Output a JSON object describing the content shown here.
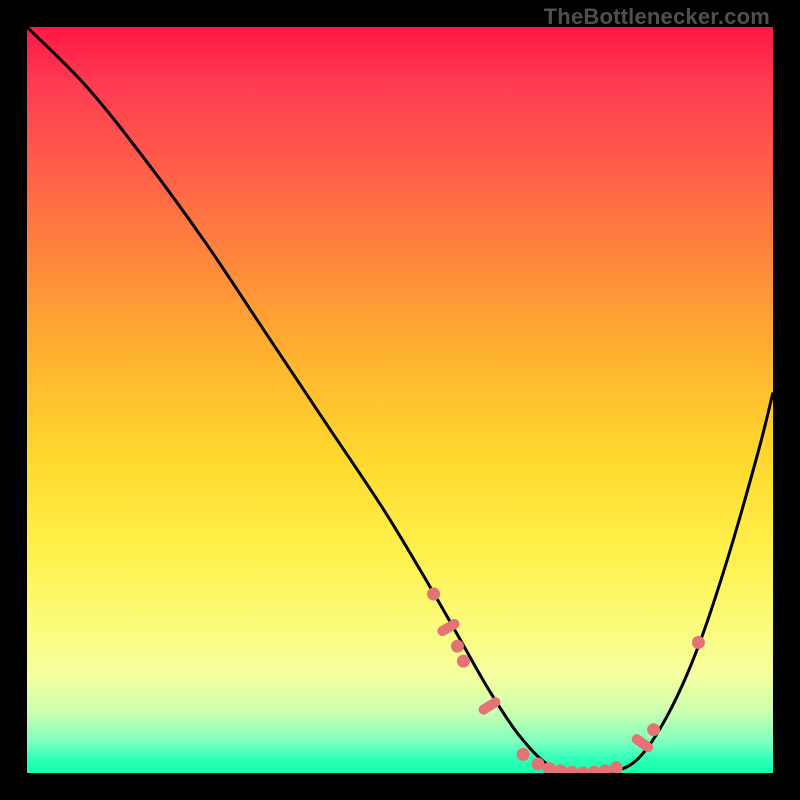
{
  "attribution": "TheBottlenecker.com",
  "chart_data": {
    "type": "line",
    "title": "",
    "xlabel": "",
    "ylabel": "",
    "xlim": [
      0,
      100
    ],
    "ylim": [
      0,
      100
    ],
    "series": [
      {
        "name": "curve",
        "x": [
          0,
          8,
          16,
          24,
          32,
          40,
          48,
          54,
          58,
          62,
          66,
          70,
          74,
          78,
          82,
          86,
          90,
          94,
          98,
          100
        ],
        "values": [
          100,
          92,
          82,
          71,
          59,
          47,
          35,
          25,
          18,
          11,
          5,
          1,
          0,
          0,
          2,
          8,
          17,
          29,
          43,
          51
        ]
      }
    ],
    "markers": [
      {
        "shape": "circle",
        "x": 54.5,
        "y": 24.0
      },
      {
        "shape": "pill",
        "x": 56.5,
        "y": 19.5,
        "angle": 60
      },
      {
        "shape": "circle",
        "x": 57.7,
        "y": 17.0
      },
      {
        "shape": "circle",
        "x": 58.5,
        "y": 15.0
      },
      {
        "shape": "pill",
        "x": 62.0,
        "y": 9.0,
        "angle": 58
      },
      {
        "shape": "circle",
        "x": 66.5,
        "y": 2.5
      },
      {
        "shape": "circle",
        "x": 68.5,
        "y": 1.2
      },
      {
        "shape": "circle",
        "x": 70.0,
        "y": 0.6
      },
      {
        "shape": "circle",
        "x": 71.5,
        "y": 0.3
      },
      {
        "shape": "circle",
        "x": 73.0,
        "y": 0.1
      },
      {
        "shape": "circle",
        "x": 74.5,
        "y": 0.0
      },
      {
        "shape": "circle",
        "x": 76.0,
        "y": 0.1
      },
      {
        "shape": "circle",
        "x": 77.5,
        "y": 0.3
      },
      {
        "shape": "circle",
        "x": 79.0,
        "y": 0.7
      },
      {
        "shape": "pill",
        "x": 82.5,
        "y": 4.0,
        "angle": -55
      },
      {
        "shape": "circle",
        "x": 84.0,
        "y": 5.8
      },
      {
        "shape": "circle",
        "x": 90.0,
        "y": 17.5
      }
    ]
  }
}
